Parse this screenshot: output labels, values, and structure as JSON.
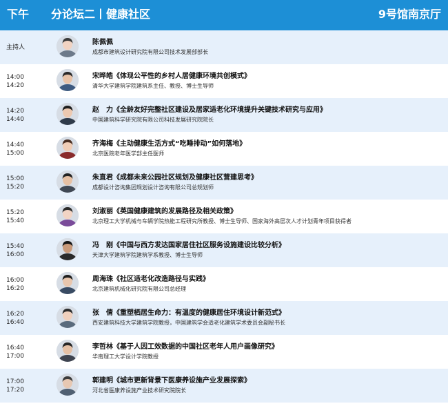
{
  "header": {
    "session": "下午",
    "title": "分论坛二丨健康社区",
    "venue": "9号馆南京厅"
  },
  "colors": {
    "header_bg": "#1d8fd6",
    "row_alt_bg": "#e6f0fb"
  },
  "rows": [
    {
      "time": "主持人",
      "time_end": "",
      "name": "陈佩佩",
      "talk": "",
      "affiliation": "成都市建筑设计研究院有限公司技术发展部部长"
    },
    {
      "time": "14:00",
      "time_end": "14:20",
      "name": "宋晔皓",
      "talk": "《体现公平性的乡村人居健康环境共创模式》",
      "affiliation": "清华大学建筑学院建筑系主任、教授、博士生导师"
    },
    {
      "time": "14:20",
      "time_end": "14:40",
      "name": "赵　力",
      "talk": "《全龄友好完整社区建设及居家适老化环境提升关键技术研究与应用》",
      "affiliation": "中国建筑科学研究院有限公司科技发展研究院院长"
    },
    {
      "time": "14:40",
      "time_end": "15:00",
      "name": "齐海梅",
      "talk": "《主动健康生活方式“吃睡排动”如何落地》",
      "affiliation": "北京医院老年医学部主任医师"
    },
    {
      "time": "15:00",
      "time_end": "15:20",
      "name": "朱直君",
      "talk": "《成都未来公园社区规划及健康社区营建思考》",
      "affiliation": "成都设计咨询集团规划设计咨询有限公司总规划师"
    },
    {
      "time": "15:20",
      "time_end": "15:40",
      "name": "刘淑丽",
      "talk": "《英国健康建筑的发展路径及相关政策》",
      "affiliation": "北京理工大学机械与车辆学院热能工程研究所教授、博士生导师、国家海外高层次人才计划青年项目获得者"
    },
    {
      "time": "15:40",
      "time_end": "16:00",
      "name": "冯　刚",
      "talk": "《中国与西方发达国家居住社区服务设施建设比较分析》",
      "affiliation": "天津大学建筑学院建筑学系教授、博士生导师"
    },
    {
      "time": "16:00",
      "time_end": "16:20",
      "name": "周海珠",
      "talk": "《社区适老化改造路径与实践》",
      "affiliation": "北京建筑机械化研究院有限公司总经理"
    },
    {
      "time": "16:20",
      "time_end": "16:40",
      "name": "张　倩",
      "talk": "《重塑栖居生命力：有温度的健康居住环境设计新范式》",
      "affiliation": "西安建筑科技大学建筑学院教授，中国建筑学会适老化建筑学术委员会副秘书长"
    },
    {
      "time": "16:40",
      "time_end": "17:00",
      "name": "李哲林",
      "talk": "《基于人因工效数据的中国社区老年人用户画像研究》",
      "affiliation": "华南理工大学设计学院教授"
    },
    {
      "time": "17:00",
      "time_end": "17:20",
      "name": "郭建明",
      "talk": "《城市更新背景下医康养设施产业发展探索》",
      "affiliation": "河北省医康养设施产业技术研究院院长"
    }
  ]
}
